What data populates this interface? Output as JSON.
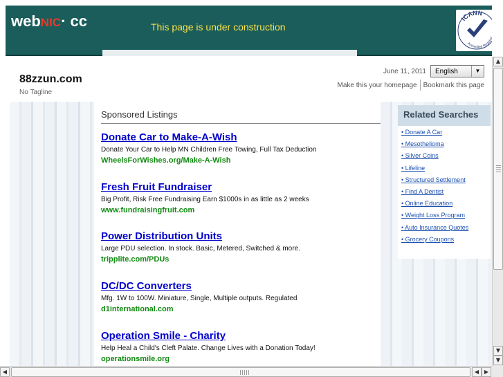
{
  "banner": {
    "logo_web": "web",
    "logo_nic": "NIC",
    "logo_cc": "· cc",
    "message": "This page is under construction",
    "badge_text": "ICANN Accredited Registrar"
  },
  "header": {
    "site_title": "88zzun.com",
    "tagline": "No Tagline",
    "date": "June 11, 2011",
    "language": "English",
    "homepage_link": "Make this your homepage",
    "bookmark_link": "Bookmark this page"
  },
  "sponsored": {
    "heading": "Sponsored Listings",
    "listings": [
      {
        "title": "Donate Car to Make-A-Wish",
        "description": "Donate Your Car to Help MN Children Free Towing, Full Tax Deduction",
        "url": "WheelsForWishes.org/Make-A-Wish"
      },
      {
        "title": "Fresh Fruit Fundraiser",
        "description": "Big Profit, Risk Free Fundraising Earn $1000s in as little as 2 weeks",
        "url": "www.fundraisingfruit.com"
      },
      {
        "title": "Power Distribution Units",
        "description": "Large PDU selection. In stock. Basic, Metered, Switched & more.",
        "url": "tripplite.com/PDUs"
      },
      {
        "title": "DC/DC Converters",
        "description": "Mfg. 1W to 100W. Miniature, Single, Multiple outputs. Regulated",
        "url": "d1international.com"
      },
      {
        "title": "Operation Smile - Charity",
        "description": "Help Heal a Child's Cleft Palate. Change Lives with a Donation Today!",
        "url": "operationsmile.org"
      }
    ]
  },
  "related": {
    "heading": "Related Searches",
    "items": [
      "• Donate A Car",
      "• Mesothelioma",
      "• Silver Coins",
      "• Lifeline",
      "• Structured Settlement",
      "• Find A Dentist",
      "• Online Education",
      "• Weight Loss Program",
      "• Auto Insurance Quotes",
      "• Grocery Coupons"
    ]
  },
  "colors": {
    "banner_bg": "#1a5d5a",
    "banner_text": "#ffe34a",
    "link_blue": "#0000cc",
    "url_green": "#118a11",
    "related_head_bg": "#cfdde8"
  },
  "icons": {
    "dropdown": "chevron-down-icon",
    "scroll_up": "arrow-up-icon",
    "scroll_down": "arrow-down-icon",
    "scroll_left": "arrow-left-icon",
    "scroll_right": "arrow-right-icon"
  }
}
